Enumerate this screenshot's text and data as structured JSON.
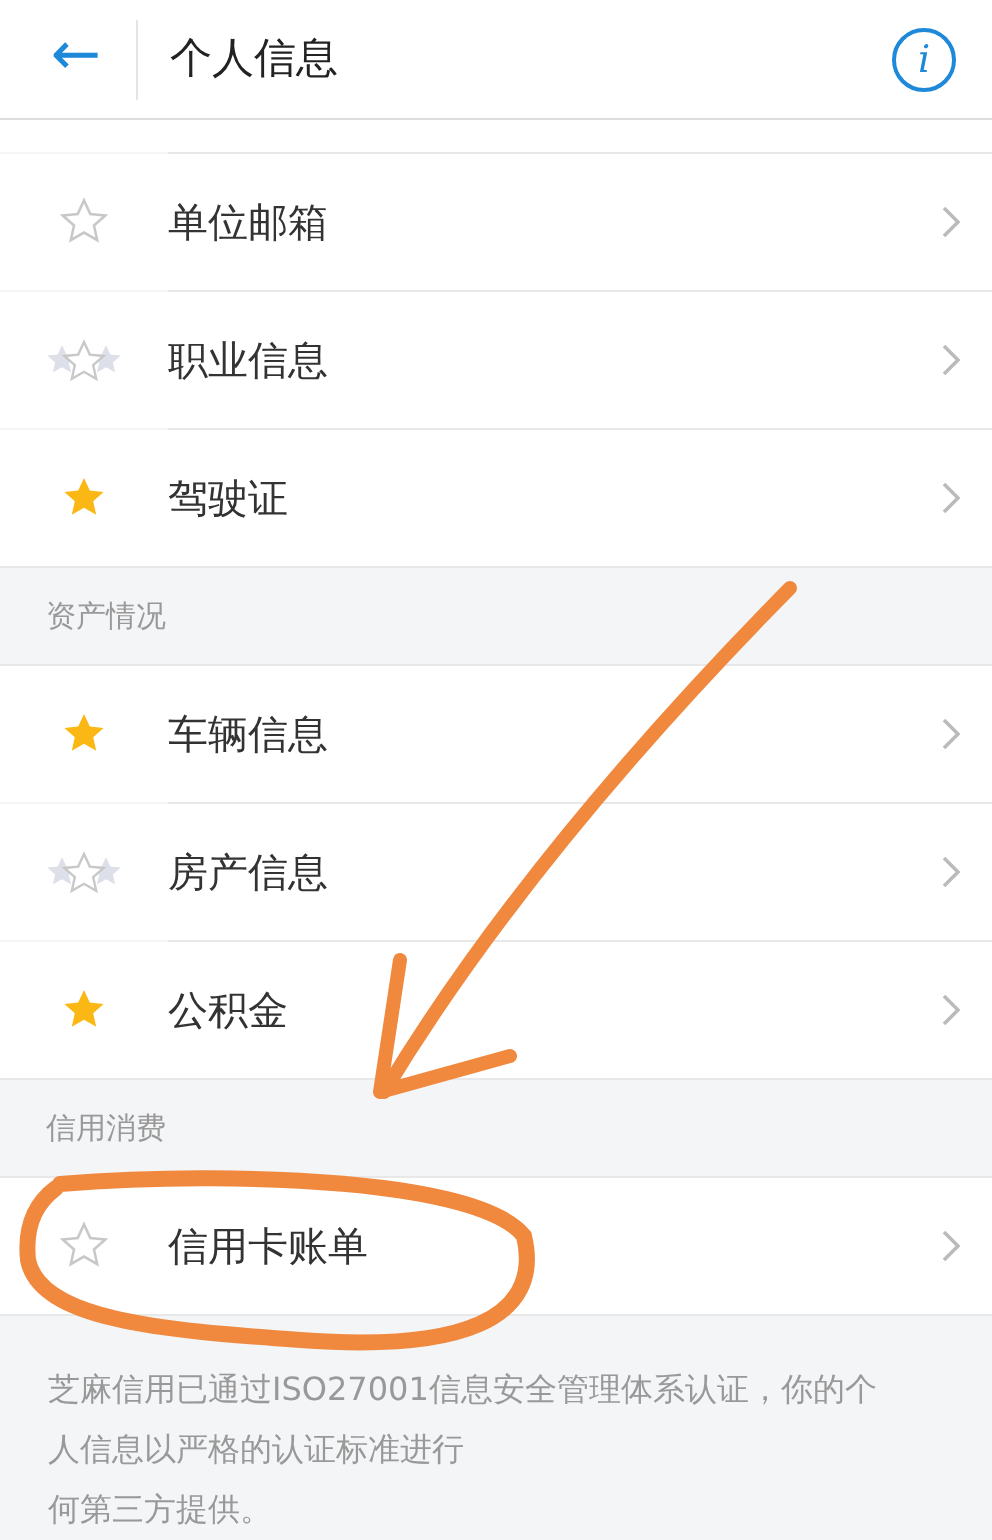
{
  "header": {
    "back": "←",
    "title": "个人信息",
    "info": "i"
  },
  "sections": [
    {
      "items": [
        {
          "label": "单位邮箱",
          "kind": "empty"
        },
        {
          "label": "职业信息",
          "kind": "partial"
        },
        {
          "label": "驾驶证",
          "kind": "filled"
        }
      ]
    },
    {
      "heading": "资产情况",
      "items": [
        {
          "label": "车辆信息",
          "kind": "filled"
        },
        {
          "label": "房产信息",
          "kind": "partial"
        },
        {
          "label": "公积金",
          "kind": "filled"
        }
      ]
    },
    {
      "heading": "信用消费",
      "items": [
        {
          "label": "信用卡账单",
          "kind": "empty"
        }
      ]
    }
  ],
  "footer_lines": [
    "芝麻信用已通过ISO27001信息安全管理体系认证，你的个",
    "人信息以严格的认证标准进行",
    "何第三方提供。"
  ]
}
